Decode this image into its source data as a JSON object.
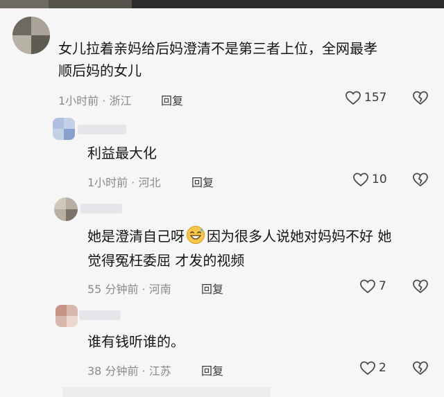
{
  "comments": [
    {
      "lines": [
        "女儿拉着亲妈给后妈澄清不是第三者上位，全网最孝",
        "顺后妈的女儿"
      ],
      "meta": "1小时前 · 浙江",
      "reply": "回复",
      "likes": "157"
    },
    {
      "lines": [
        "利益最大化"
      ],
      "meta": "1小时前 · 河北",
      "reply": "回复",
      "likes": "10"
    },
    {
      "line1_before": "她是澄清自己呀",
      "line1_after": "因为很多人说她对妈妈不好 她",
      "line2": "觉得冤枉委屈 才发的视频",
      "emoji": "grinning-sweat-emoji",
      "meta": "55 分钟前 · 河南",
      "reply": "回复",
      "likes": "7"
    },
    {
      "lines": [
        "谁有钱听谁的。"
      ],
      "meta": "38 分钟前 · 江苏",
      "reply": "回复",
      "likes": "2"
    }
  ],
  "icons": {
    "like": "heart-outline-icon",
    "dislike": "broken-heart-icon"
  },
  "colors": {
    "text": "#151515",
    "meta": "#8a8a8a",
    "background": "#f6f6f6"
  }
}
